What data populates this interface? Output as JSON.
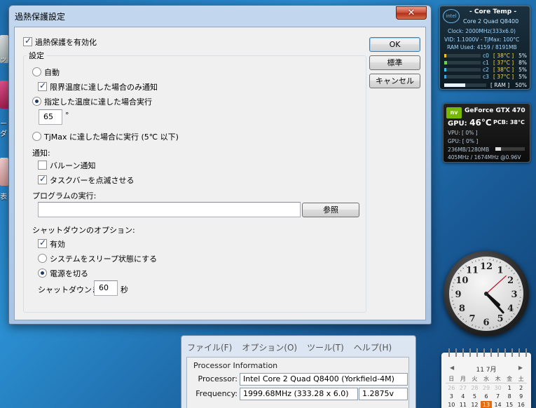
{
  "dialog": {
    "title": "過熱保護設定",
    "close_glyph": "✕",
    "enable_label": "過熱保護を有効化",
    "enable_checked": true,
    "settings_legend": "設定",
    "auto_label": "自動",
    "notify_only_label": "限界温度に達した場合のみ通知",
    "notify_only_checked": true,
    "at_temp_label": "指定した温度に達した場合実行",
    "temp_value": "65",
    "temp_unit": "°",
    "tjmax_label": "TjMax に達した場合に実行 (5℃ 以下)",
    "selected_mode": "at_temp",
    "notify_heading": "通知:",
    "balloon_label": "バルーン通知",
    "balloon_checked": false,
    "flash_taskbar_label": "タスクバーを点滅させる",
    "flash_taskbar_checked": true,
    "program_heading": "プログラムの実行:",
    "program_value": "",
    "browse_label": "参照",
    "shutdown_heading": "シャットダウンのオプション:",
    "shutdown_enable_label": "有効",
    "shutdown_enable_checked": true,
    "sleep_label": "システムをスリープ状態にする",
    "power_off_label": "電源を切る",
    "shutdown_mode": "power_off",
    "shutdown_delay_prefix": "シャットダウンまで",
    "shutdown_delay_value": "60",
    "shutdown_delay_unit": "秒",
    "ok_label": "OK",
    "default_label": "標準",
    "cancel_label": "キャンセル"
  },
  "coretemp_gadget": {
    "logo": "intel",
    "title": "- Core Temp -",
    "cpu": "Core 2 Quad Q8400",
    "clock": "Clock: 2000MHz(333x6.0)",
    "vid": "VID: 1.1000V - TjMax: 100°C",
    "ram_used": "RAM Used: 4159 / 8191MB",
    "cores": [
      {
        "name": "c0",
        "temp": "[ 38°C ]",
        "load": "5%",
        "load_value": 5
      },
      {
        "name": "c1",
        "temp": "[ 37°C ]",
        "load": "8%",
        "load_value": 8
      },
      {
        "name": "c2",
        "temp": "[ 38°C ]",
        "load": "5%",
        "load_value": 5
      },
      {
        "name": "c3",
        "temp": "[ 37°C ]",
        "load": "5%",
        "load_value": 5
      }
    ],
    "ram_label": "[ RAM ]",
    "ram_pct": "50%",
    "ram_value": 50,
    "accent": "#8fd0ff"
  },
  "gpu_gadget": {
    "logo": "nv",
    "name": "GeForce GTX 470",
    "gpu_temp_prefix": "GPU:",
    "gpu_temp": "46°C",
    "pcb_temp": "PCB: 38°C",
    "vpu_load": "VPU: [ 0% ]",
    "gpu_load": "GPU: [ 0% ]",
    "memory": "236MB/1280MB",
    "memory_value": 18,
    "clocks": "405MHz / 1674MHz @0.96V",
    "accent": "#76b900"
  },
  "clock_gadget": {
    "numerals": [
      "12",
      "1",
      "2",
      "3",
      "4",
      "5",
      "6",
      "7",
      "8",
      "9",
      "10",
      "11"
    ],
    "hour": 4,
    "minute": 23,
    "second": 8
  },
  "calendar_gadget": {
    "month": "11 7月",
    "prev": "◀",
    "next": "▶",
    "weekdays": [
      "日",
      "月",
      "火",
      "水",
      "木",
      "金",
      "土"
    ],
    "days": [
      "26",
      "27",
      "28",
      "29",
      "30",
      "1",
      "2",
      "3",
      "4",
      "5",
      "6",
      "7",
      "8",
      "9",
      "10",
      "11",
      "12",
      "13",
      "14",
      "15",
      "16"
    ],
    "prev_month_days": 5,
    "today": "13",
    "today_color": "#e86a10"
  },
  "background_window": {
    "menu": [
      "ファイル(F)",
      "オプション(O)",
      "ツール(T)",
      "ヘルプ(H)"
    ],
    "group_title": "Processor Information",
    "processor_label": "Processor:",
    "processor_value": "Intel Core 2 Quad Q8400 (Yorkfield-4M)",
    "frequency_label": "Frequency:",
    "frequency_value": "1999.68MHz (333.28 x 6.0)",
    "voltage_value": "1.2875v"
  },
  "desktop": {
    "left_strip_text": [
      "ッ",
      "ー",
      "ダ",
      "表"
    ]
  }
}
